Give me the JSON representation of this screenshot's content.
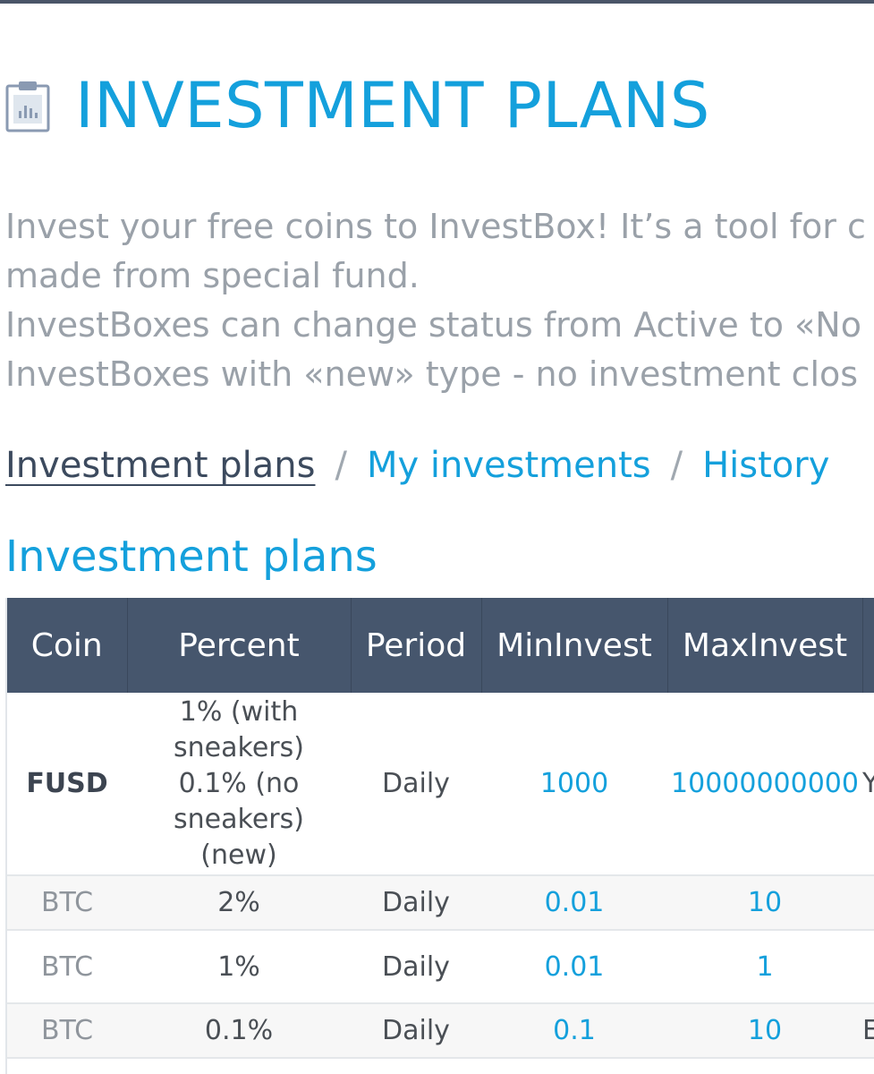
{
  "header": {
    "icon": "clipboard-chart-icon",
    "title": "INVESTMENT PLANS"
  },
  "intro": {
    "lines": [
      "Invest your free coins to InvestBox! It’s a tool for c",
      "made from special fund.",
      "InvestBoxes can change status from Active to «No",
      "InvestBoxes with «new» type - no investment clos"
    ]
  },
  "nav": {
    "active": "Investment plans",
    "separator": "/",
    "my_investments": "My investments",
    "history": "History"
  },
  "section": {
    "title": "Investment plans"
  },
  "table": {
    "columns": [
      "Coin",
      "Percent",
      "Period",
      "MinInvest",
      "MaxInvest",
      ""
    ],
    "rows": [
      {
        "coin": "FUSD",
        "percent_lines": [
          "1% (with",
          "sneakers)",
          "0.1% (no",
          "sneakers)",
          "(new)"
        ],
        "period": "Daily",
        "min": "1000",
        "max": "10000000000",
        "extra": "Y"
      },
      {
        "coin": "BTC",
        "percent": "2%",
        "period": "Daily",
        "min": "0.01",
        "max": "10",
        "extra": ""
      },
      {
        "coin": "BTC",
        "percent": "1%",
        "period": "Daily",
        "min": "0.01",
        "max": "1",
        "extra": ""
      },
      {
        "coin": "BTC",
        "percent": "0.1%",
        "period": "Daily",
        "min": "0.1",
        "max": "10",
        "extra": "E"
      }
    ]
  },
  "colors": {
    "accent": "#14a0dc",
    "header_bg": "#46566d",
    "muted_text": "#9aa1a9"
  }
}
